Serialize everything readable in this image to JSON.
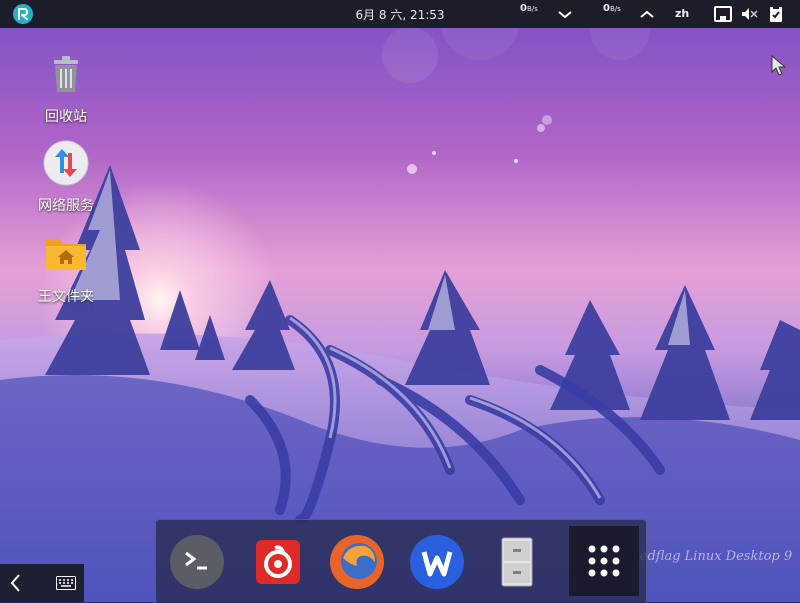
{
  "topbar": {
    "clock": "6月  8 六, 21:53",
    "net_down_value": "0",
    "net_down_unit": "B/s",
    "net_up_value": "0",
    "net_up_unit": "B/s",
    "language": "zh"
  },
  "desktop_icons": [
    {
      "label": "回收站",
      "icon": "trash-icon"
    },
    {
      "label": "网络服务",
      "icon": "network-service-icon"
    },
    {
      "label": "王文件夹",
      "icon": "home-folder-icon"
    }
  ],
  "dock": {
    "items": [
      "terminal-icon",
      "netease-music-icon",
      "firefox-icon",
      "wps-office-icon",
      "file-cabinet-icon",
      "app-grid-icon"
    ]
  },
  "watermark": "Redflag Linux Desktop 9",
  "colors": {
    "topbar": "#1b1d2a",
    "logo": "#27b3c6",
    "dock": "#282c50"
  }
}
